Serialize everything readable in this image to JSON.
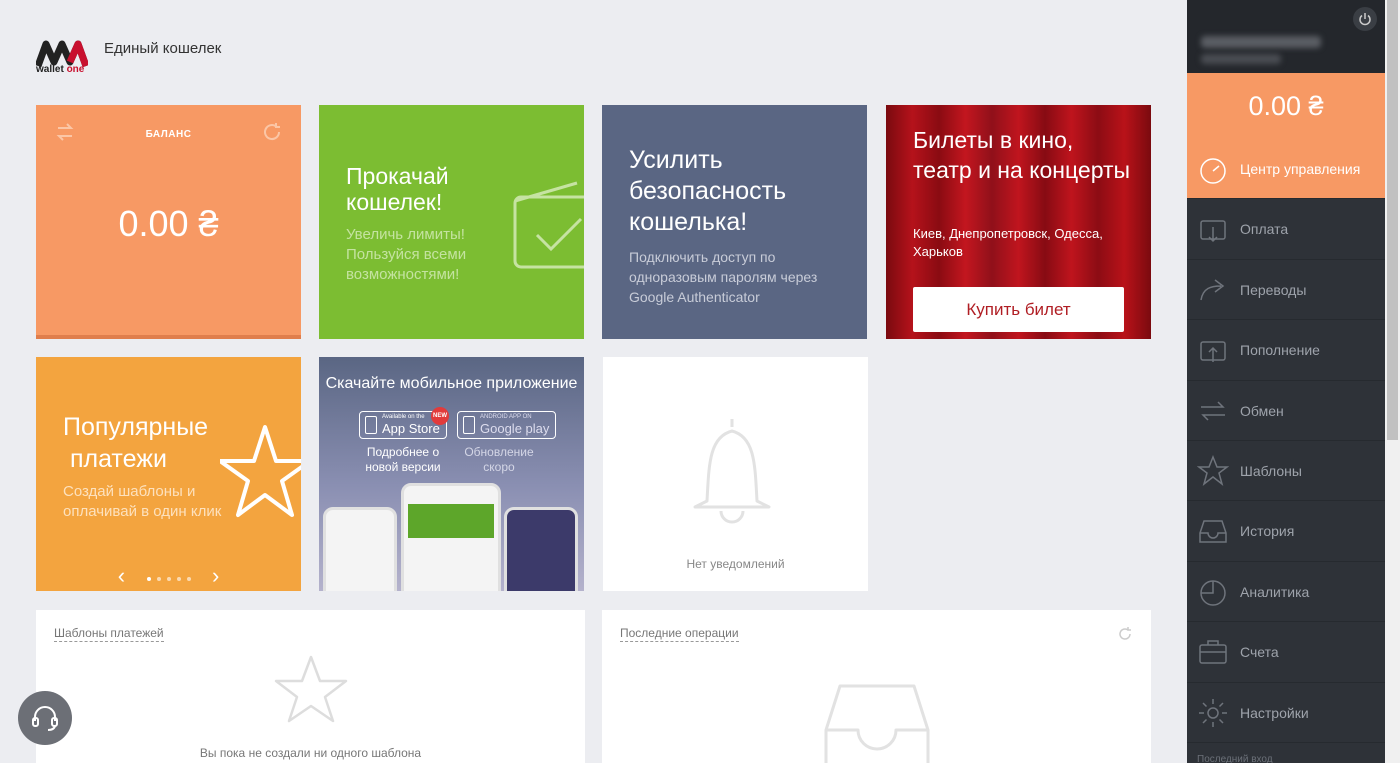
{
  "header": {
    "logo_text": "wallet",
    "logo_text_brand": "one",
    "title": "Единый кошелек"
  },
  "balance": {
    "label": "БАЛАНС",
    "amount": "0.00 ₴"
  },
  "promo_limits": {
    "title_line1": "Прокачай",
    "title_line2": "кошелек!",
    "text": "Увеличь лимиты! Пользуйся всеми возможностями!"
  },
  "security": {
    "title": "Усилить безопасность кошелька!",
    "text": "Подключить доступ по одноразовым паролям через Google Authenticator"
  },
  "cinema": {
    "title": "Билеты в кино, театр и на концерты",
    "cities": "Киев, Днепропетровск, Одесса, Харьков",
    "button": "Купить билет"
  },
  "popular": {
    "title_line1": "Популярные",
    "title_line2": " платежи",
    "text": "Создай шаблоны и оплачивай в один клик",
    "carousel_prev": "‹",
    "carousel_next": "›"
  },
  "mobile_app": {
    "title": "Скачайте мобильное приложение",
    "appstore_small": "Available on the",
    "appstore": "App Store",
    "new_badge": "NEW",
    "googleplay_small": "ANDROID APP ON",
    "googleplay": "Google play",
    "more": "Подробнее о новой версии",
    "soon": "Обновление скоро"
  },
  "notifications": {
    "empty": "Нет уведомлений"
  },
  "templates_panel": {
    "title": "Шаблоны платежей",
    "empty": "Вы пока не создали ни одного шаблона"
  },
  "last_ops_panel": {
    "title": "Последние операции"
  },
  "sidebar": {
    "balance": "0.00 ₴",
    "items": [
      {
        "label": "Центр управления",
        "icon": "dashboard-icon"
      },
      {
        "label": "Оплата",
        "icon": "wallet-icon"
      },
      {
        "label": "Переводы",
        "icon": "transfer-arrow-icon"
      },
      {
        "label": "Пополнение",
        "icon": "topup-icon"
      },
      {
        "label": "Обмен",
        "icon": "exchange-icon"
      },
      {
        "label": "Шаблоны",
        "icon": "star-icon"
      },
      {
        "label": "История",
        "icon": "inbox-icon"
      },
      {
        "label": "Аналитика",
        "icon": "pie-chart-icon"
      },
      {
        "label": "Счета",
        "icon": "briefcase-icon"
      },
      {
        "label": "Настройки",
        "icon": "gear-icon"
      }
    ],
    "footer": "Последний вход"
  },
  "colors": {
    "accent": "#f79964",
    "green": "#7cbd32",
    "slate": "#5a6683",
    "sidebar": "#2e3238"
  }
}
